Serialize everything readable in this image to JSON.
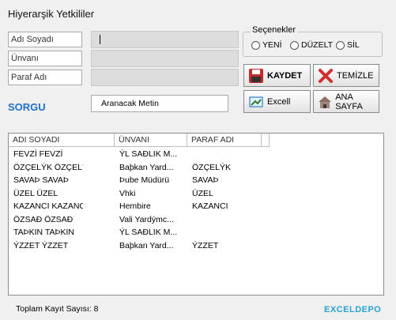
{
  "window": {
    "title": "Hiyerarşik Yetkililer"
  },
  "form": {
    "fields": [
      {
        "label": "Adı Soyadı",
        "value": ""
      },
      {
        "label": "Ünvanı",
        "value": ""
      },
      {
        "label": "Paraf Adı",
        "value": ""
      }
    ]
  },
  "options": {
    "legend": "Seçenekler",
    "items": [
      "YENİ",
      "DÜZELT",
      "SİL"
    ]
  },
  "buttons": {
    "save": "KAYDET",
    "clear": "TEMİZLE",
    "excel": "Excell",
    "home": "ANA SAYFA"
  },
  "search": {
    "label": "SORGU",
    "value": "Aranacak Metin"
  },
  "table": {
    "columns": [
      "ADI SOYADI",
      "ÜNVANI",
      "PARAF ADI"
    ],
    "rows": [
      [
        "FEVZİ FEVZİ",
        "ÝL SAĐLIK M...",
        ""
      ],
      [
        "ÖZÇELÝK ÖZÇELÝ",
        "Baþkan Yard...",
        "ÖZÇELÝK"
      ],
      [
        "SAVAÞ SAVAÞ",
        "Þube Müdürü",
        "SAVAÞ"
      ],
      [
        "ÜZEL ÜZEL",
        "Vhki",
        "ÜZEL"
      ],
      [
        "KAZANCI KAZANCI",
        "Hembire",
        "KAZANCI"
      ],
      [
        "ÖZSAĐ ÖZSAĐ",
        "Vali Yardýmc...",
        ""
      ],
      [
        "TAÞKIN TAÞKIN",
        "ÝL SAĐLIK M...",
        ""
      ],
      [
        "ÝZZET ÝZZET",
        "Baþkan Yard...",
        "ÝZZET"
      ]
    ]
  },
  "status": {
    "text": "Toplam Kayıt Sayısı: 8"
  },
  "logo": {
    "part1": "EXCEL",
    "part2": "DEPO"
  }
}
